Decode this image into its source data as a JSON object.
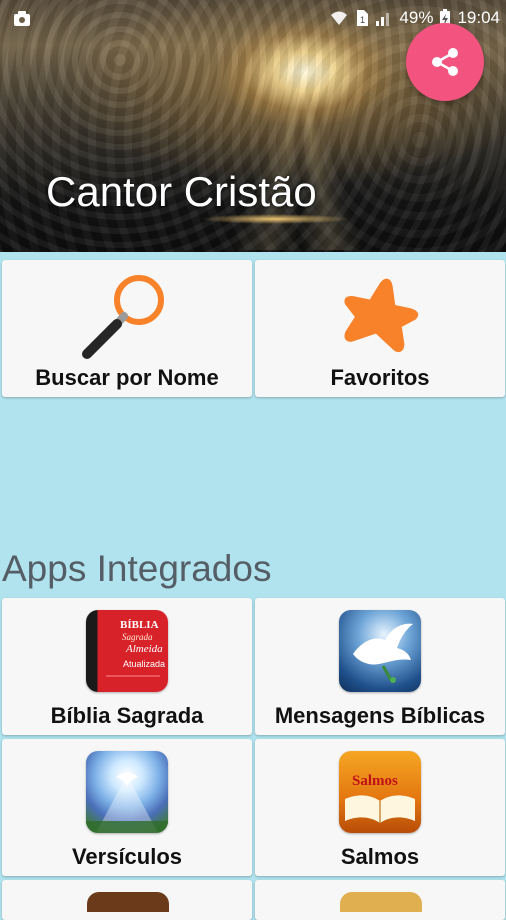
{
  "status_bar": {
    "battery": "49%",
    "time": "19:04"
  },
  "header": {
    "title": "Cantor Cristão"
  },
  "main_actions": [
    {
      "label": "Buscar por Nome",
      "icon": "magnifier-icon"
    },
    {
      "label": "Favoritos",
      "icon": "star-icon"
    }
  ],
  "integrated_apps": {
    "title": "Apps Integrados",
    "items": [
      {
        "label": "Bíblia Sagrada",
        "icon": "bible-book-icon",
        "icon_text": "BÍBLIA Sagrada Almeida Atualizada"
      },
      {
        "label": "Mensagens Bíblicas",
        "icon": "dove-icon"
      },
      {
        "label": "Versículos",
        "icon": "dove-light-icon"
      },
      {
        "label": "Salmos",
        "icon": "psalms-book-icon",
        "icon_text": "Salmos"
      }
    ]
  },
  "colors": {
    "background": "#b0e3ee",
    "fab": "#f2537f",
    "star": "#f7822a",
    "magnifier": "#f7822a"
  }
}
